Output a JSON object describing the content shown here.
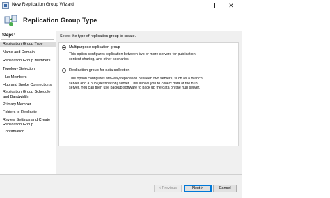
{
  "window": {
    "title": "New Replication Group Wizard",
    "controls": {
      "minimize": "",
      "maximize": "",
      "close": "✕"
    }
  },
  "header": {
    "title": "Replication Group Type"
  },
  "steps": {
    "heading": "Steps:",
    "items": [
      {
        "label": "Replication Group Type",
        "active": true
      },
      {
        "label": "Name and Domain"
      },
      {
        "label": "Replication Group Members"
      },
      {
        "label": "Topology Selection"
      },
      {
        "label": "Hub Members"
      },
      {
        "label": "Hub and Spoke Connections"
      },
      {
        "label": "Replication Group Schedule and Bandwidth"
      },
      {
        "label": "Primary Member"
      },
      {
        "label": "Folders to Replicate"
      },
      {
        "label": "Review Settings and Create Replication Group"
      },
      {
        "label": "Confirmation"
      }
    ]
  },
  "content": {
    "instruction": "Select the type of replication group to create.",
    "options": [
      {
        "label": "Multipurpose replication group",
        "checked": true,
        "description": "This option configures replication between two or more servers for publication, content sharing, and other scenarios."
      },
      {
        "label": "Replication group for data collection",
        "checked": false,
        "description": "This option configures two-way replication between two servers, such as a branch server and a hub (destination) server. This allows you to collect data at the hub server. You can then use backup software to back up the data on the hub server."
      }
    ]
  },
  "footer": {
    "previous_label": "< Previous",
    "next_label": "Next >",
    "cancel_label": "Cancel"
  },
  "colors": {
    "accent": "#0078d7",
    "selected_step": "#dcdcdc",
    "panel": "#f0f0f0"
  }
}
